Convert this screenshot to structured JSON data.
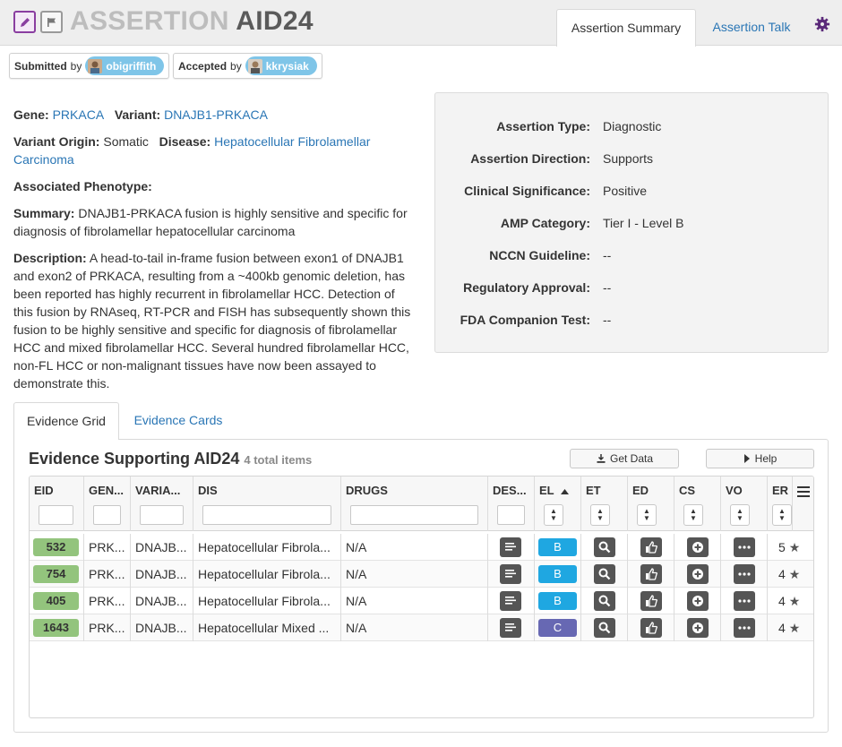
{
  "header": {
    "title_prefix": "ASSERTION",
    "title_id": "AID24",
    "tabs": [
      {
        "label": "Assertion Summary"
      },
      {
        "label": "Assertion Talk"
      }
    ]
  },
  "submitted": {
    "label": "Submitted",
    "by": "by",
    "user": "obigriffith"
  },
  "accepted": {
    "label": "Accepted",
    "by": "by",
    "user": "kkrysiak"
  },
  "details": {
    "gene_label": "Gene:",
    "gene": "PRKACA",
    "variant_label": "Variant:",
    "variant": "DNAJB1-PRKACA",
    "origin_label": "Variant Origin:",
    "origin": "Somatic",
    "disease_label": "Disease:",
    "disease": "Hepatocellular Fibrolamellar Carcinoma",
    "phenotype_label": "Associated Phenotype:",
    "summary_label": "Summary:",
    "summary": "DNAJB1-PRKACA fusion is highly sensitive and specific for diagnosis of fibrolamellar hepatocellular carcinoma",
    "description_label": "Description:",
    "description": "A head-to-tail in-frame fusion between exon1 of DNAJB1 and exon2 of PRKACA, resulting from a ~400kb genomic deletion, has been reported has highly recurrent in fibrolamellar HCC. Detection of this fusion by RNAseq, RT-PCR and FISH has subsequently shown this fusion to be highly sensitive and specific for diagnosis of fibrolamellar HCC and mixed fibrolamellar HCC. Several hundred fibrolamellar HCC, non-FL HCC or non-malignant tissues have now been assayed to demonstrate this."
  },
  "info": [
    {
      "k": "Assertion Type:",
      "v": "Diagnostic"
    },
    {
      "k": "Assertion Direction:",
      "v": "Supports"
    },
    {
      "k": "Clinical Significance:",
      "v": "Positive"
    },
    {
      "k": "AMP Category:",
      "v": "Tier I - Level B"
    },
    {
      "k": "NCCN Guideline:",
      "v": "--"
    },
    {
      "k": "Regulatory Approval:",
      "v": "--"
    },
    {
      "k": "FDA Companion Test:",
      "v": "--"
    }
  ],
  "evidence_tabs": [
    {
      "label": "Evidence Grid"
    },
    {
      "label": "Evidence Cards"
    }
  ],
  "grid": {
    "title": "Evidence Supporting AID24",
    "count": "4 total items",
    "get_data": "Get Data",
    "help": "Help",
    "columns": [
      "EID",
      "GEN...",
      "VARIA...",
      "DIS",
      "DRUGS",
      "DES...",
      "EL",
      "ET",
      "ED",
      "CS",
      "VO",
      "ER"
    ],
    "rows": [
      {
        "eid": "532",
        "gene": "PRK...",
        "variant": "DNAJB...",
        "disease": "Hepatocellular Fibrola...",
        "drugs": "N/A",
        "level": "B",
        "rating": "5"
      },
      {
        "eid": "754",
        "gene": "PRK...",
        "variant": "DNAJB...",
        "disease": "Hepatocellular Fibrola...",
        "drugs": "N/A",
        "level": "B",
        "rating": "4"
      },
      {
        "eid": "405",
        "gene": "PRK...",
        "variant": "DNAJB...",
        "disease": "Hepatocellular Fibrola...",
        "drugs": "N/A",
        "level": "B",
        "rating": "4"
      },
      {
        "eid": "1643",
        "gene": "PRK...",
        "variant": "DNAJB...",
        "disease": "Hepatocellular Mixed ...",
        "drugs": "N/A",
        "level": "C",
        "rating": "4"
      }
    ]
  },
  "colors": {
    "accent": "#8a3ea0",
    "link": "#2a76b5",
    "eid_badge": "#93c47d",
    "level_b": "#1fa7e1",
    "level_c": "#6768b3",
    "user_pill": "#7fc5e8"
  }
}
